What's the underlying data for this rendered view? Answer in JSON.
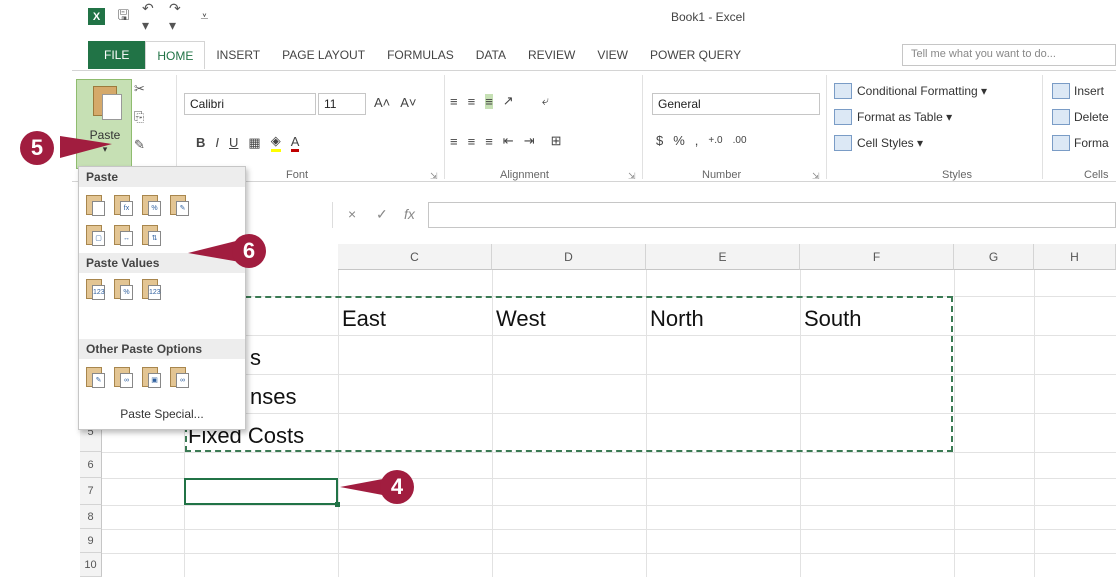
{
  "window": {
    "title": "Book1 - Excel"
  },
  "qat": {
    "logo": "X",
    "save": "🖫",
    "undo": "↶ ▾",
    "redo": "↷ ▾",
    "more": "⩡"
  },
  "tabs": [
    {
      "label": "FILE"
    },
    {
      "label": "HOME"
    },
    {
      "label": "INSERT"
    },
    {
      "label": "PAGE LAYOUT"
    },
    {
      "label": "FORMULAS"
    },
    {
      "label": "DATA"
    },
    {
      "label": "REVIEW"
    },
    {
      "label": "VIEW"
    },
    {
      "label": "POWER QUERY"
    }
  ],
  "tell_me": {
    "placeholder": "Tell me what you want to do..."
  },
  "ribbon": {
    "clipboard": {
      "paste_label": "Paste",
      "paste_arrow": "▾"
    },
    "font": {
      "name": "Calibri",
      "size": "11",
      "label": "Font",
      "grow": "A˄",
      "shrink": "A˅"
    },
    "alignment": {
      "label": "Alignment"
    },
    "number": {
      "format": "General",
      "label": "Number",
      "currency": "$",
      "percent": "%",
      "comma": ","
    },
    "styles": {
      "conditional": "Conditional Formatting ▾",
      "format_table": "Format as Table ▾",
      "cell_styles": "Cell Styles ▾",
      "label": "Styles"
    },
    "cells": {
      "insert": "Insert",
      "delete": "Delete",
      "format": "Forma",
      "label": "Cells"
    }
  },
  "formula_bar": {
    "cancel": "×",
    "enter": "✓",
    "fx": "fx"
  },
  "grid": {
    "columns": [
      "C",
      "D",
      "E",
      "F",
      "G",
      "H"
    ],
    "rows": [
      "5",
      "6",
      "7",
      "8",
      "9",
      "10"
    ],
    "cells": {
      "c_east": "East",
      "d_west": "West",
      "e_north": "North",
      "f_south": "South",
      "b_sales": "s",
      "b_expenses": "nses",
      "b_fixed": "Fixed Costs"
    }
  },
  "paste_menu": {
    "paste_header": "Paste",
    "paste_values_header": "Paste Values",
    "other_header": "Other Paste Options",
    "paste_special": "Paste Special..."
  },
  "callouts": {
    "c4": "4",
    "c5": "5",
    "c6": "6"
  },
  "colors": {
    "excel_green": "#217346",
    "callout": "#a11d3f"
  }
}
